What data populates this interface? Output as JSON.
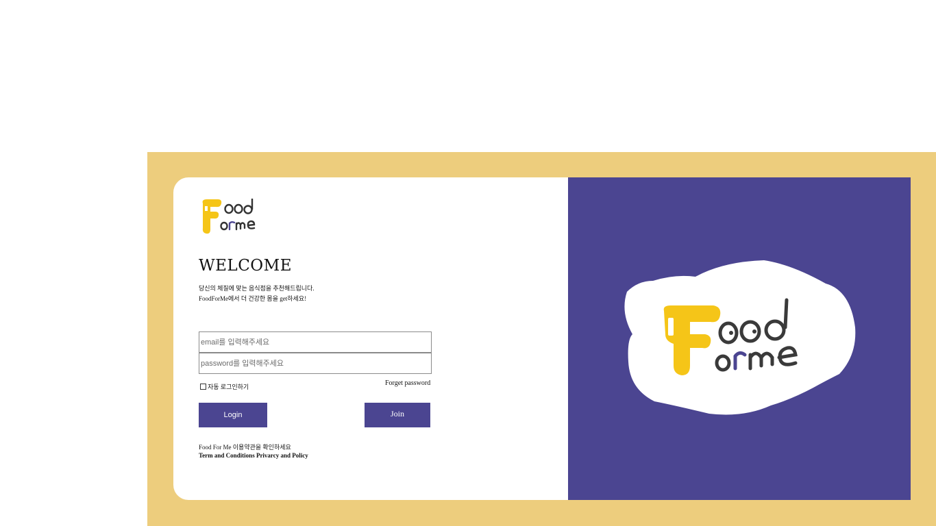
{
  "page": {
    "welcome_title": "WELCOME",
    "tagline_line1": "당신의 체질에 맞는 음식점을 추천해드립니다.",
    "tagline_line2": "FoodForMe에서 더 건강한 몸을 get하세요!"
  },
  "logo": {
    "text": "Food Forme",
    "colors": {
      "yellow": "#f5c518",
      "dark": "#3a3a3a",
      "purple": "#4b4591"
    }
  },
  "form": {
    "email_placeholder": "email를 입력해주세요",
    "password_placeholder": "password를 입력해주세요",
    "remember_label": "자동 로그인하기",
    "forget_label": "Forget password",
    "login_label": "Login",
    "join_label": "Join"
  },
  "footer": {
    "terms_line1": "Food For Me 이용약관을 확인하세요",
    "terms_line2": "Term and Conditions Privarcy and Policy"
  },
  "colors": {
    "frame": "#edcd7d",
    "panel": "#4b4591",
    "button": "#4b4591",
    "card": "#ffffff"
  }
}
